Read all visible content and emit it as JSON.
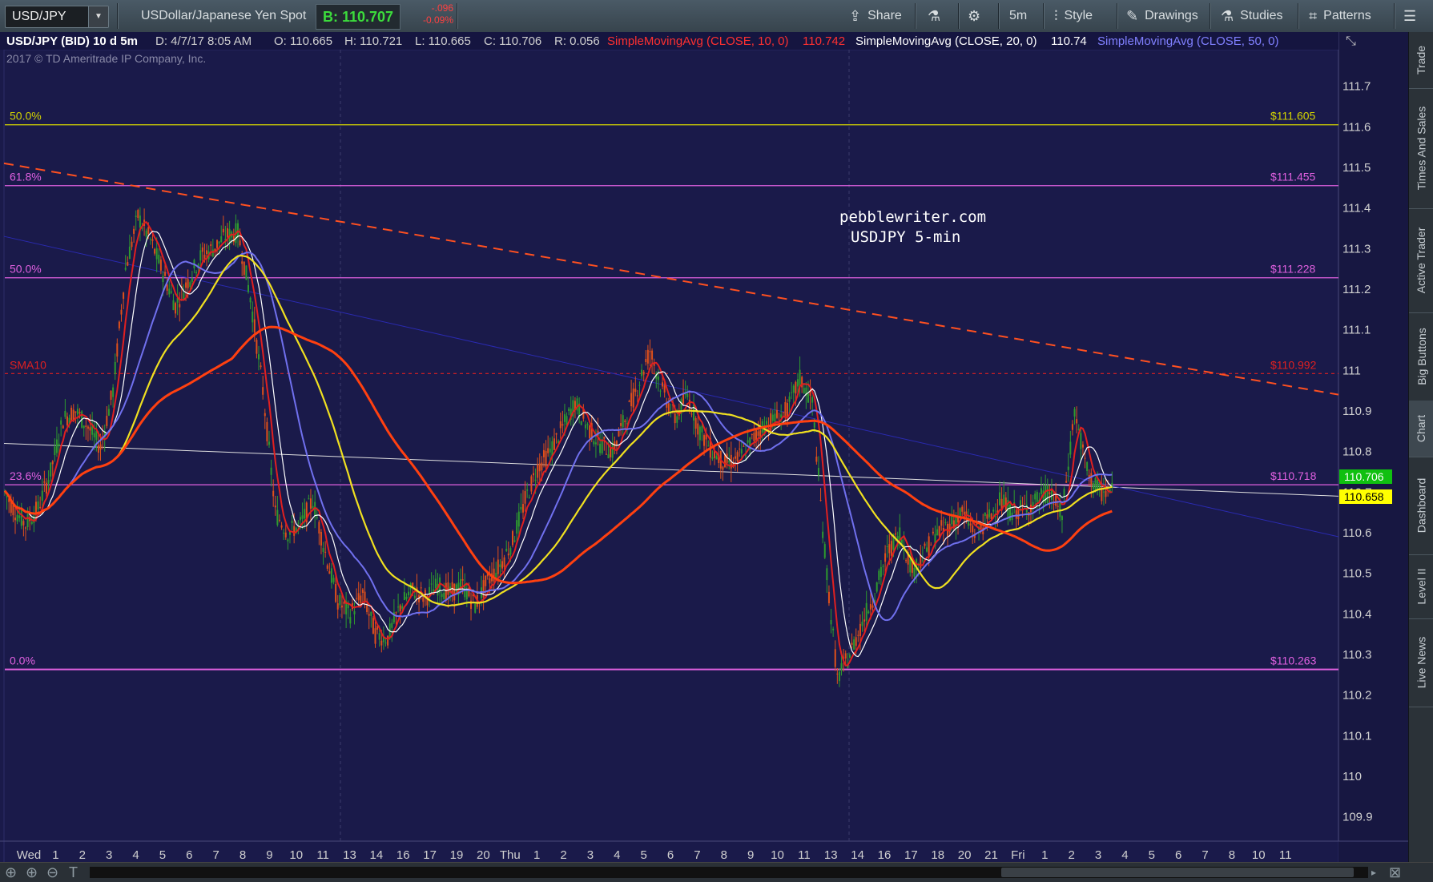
{
  "toolbar": {
    "symbol": "USD/JPY",
    "description": "USDollar/Japanese Yen Spot",
    "bid": "B: 110.707",
    "change": "-.096",
    "change_pct": "-0.09%",
    "share_label": "Share",
    "timeframe_label": "5m",
    "style_label": "Style",
    "drawings_label": "Drawings",
    "studies_label": "Studies",
    "patterns_label": "Patterns"
  },
  "header": {
    "instrument": "USD/JPY (BID) 10 d 5m",
    "date": "D: 4/7/17 8:05 AM",
    "open": "O: 110.665",
    "high": "H: 110.721",
    "low": "L: 110.665",
    "close": "C: 110.706",
    "range": "R: 0.056",
    "sma10_label": "SimpleMovingAvg (CLOSE, 10, 0)",
    "sma10_value": "110.742",
    "sma20_label": "SimpleMovingAvg (CLOSE, 20, 0)",
    "sma20_value": "110.74",
    "sma50_label": "SimpleMovingAvg (CLOSE, 50, 0)",
    "copyright": "2017 © TD Ameritrade IP Company, Inc."
  },
  "annotation": {
    "line1": "pebblewriter.com",
    "line2": "USDJPY 5-min"
  },
  "colors": {
    "background": "#1a1a4a",
    "candle_up": "#2e9a2e",
    "candle_down": "#e0501a",
    "sma10": "#e02020",
    "sma20": "#ffffff",
    "sma50": "#7070ee",
    "yellow_ma": "#f0e020",
    "orange_ma": "#ff4010",
    "fib_line": "#e060e0",
    "fib50_top": "#d4d400",
    "trendline_dashed": "#ff5020",
    "bid_label_bg": "#10c010",
    "price_label_bg": "#ffff00"
  },
  "side_tabs": [
    "Trade",
    "Times And Sales",
    "Active Trader",
    "Big Buttons",
    "Chart",
    "Dashboard",
    "Level II",
    "Live News"
  ],
  "chart_data": {
    "type": "candlestick",
    "title": "USDJPY 5-min",
    "ylim": [
      109.84,
      111.79
    ],
    "y_ticks": [
      "111.7",
      "111.6",
      "111.5",
      "111.4",
      "111.3",
      "111.2",
      "111.1",
      "111",
      "110.9",
      "110.8",
      "110.7",
      "110.6",
      "110.5",
      "110.4",
      "110.3",
      "110.2",
      "110.1",
      "110",
      "109.9"
    ],
    "x_ticks": [
      "Wed",
      "1",
      "2",
      "3",
      "4",
      "5",
      "6",
      "7",
      "8",
      "9",
      "10",
      "11",
      "13",
      "14",
      "16",
      "17",
      "19",
      "20",
      "Thu",
      "1",
      "2",
      "3",
      "4",
      "5",
      "6",
      "7",
      "8",
      "9",
      "10",
      "11",
      "13",
      "14",
      "16",
      "17",
      "18",
      "20",
      "21",
      "Fri",
      "1",
      "2",
      "3",
      "4",
      "5",
      "6",
      "7",
      "8",
      "10",
      "11"
    ],
    "fib_levels": [
      {
        "label": "50.0%",
        "value": 111.605,
        "price_label": "$111.605"
      },
      {
        "label": "61.8%",
        "value": 111.455,
        "price_label": "$111.455"
      },
      {
        "label": "50.0%",
        "value": 111.228,
        "price_label": "$111.228"
      },
      {
        "label": "SMA10",
        "value": 110.992,
        "price_label": "$110.992"
      },
      {
        "label": "23.6%",
        "value": 110.718,
        "price_label": "$110.718"
      },
      {
        "label": "0.0%",
        "value": 110.263,
        "price_label": "$110.263"
      }
    ],
    "current_bid_label": "110.706",
    "current_ma_label": "110.658",
    "series": [
      {
        "name": "price",
        "t": [
          0,
          2,
          5,
          8,
          11,
          14,
          17,
          20,
          23,
          26,
          29,
          32,
          35,
          38,
          41,
          44,
          47,
          50,
          53,
          56,
          59,
          62,
          65,
          68,
          71,
          74,
          77,
          80,
          83,
          86,
          89,
          92,
          95,
          98,
          101,
          104,
          107,
          110,
          113,
          116,
          119,
          122,
          125,
          128,
          131,
          134,
          137,
          140,
          143,
          146,
          149,
          152,
          155,
          158,
          161,
          164,
          167,
          170,
          173,
          176,
          179,
          182,
          185,
          188,
          191,
          194,
          197,
          200,
          203,
          206,
          209,
          212,
          215,
          218,
          221,
          224,
          227,
          230,
          233,
          236,
          239,
          242,
          245,
          248,
          251,
          254,
          257,
          260,
          263,
          266,
          269,
          272,
          275,
          278,
          281,
          284,
          287,
          290,
          293,
          296,
          299
        ],
        "v": [
          110.7,
          110.66,
          110.62,
          110.66,
          110.75,
          110.88,
          110.9,
          110.86,
          110.81,
          110.95,
          111.25,
          111.38,
          111.32,
          111.24,
          111.16,
          111.22,
          111.28,
          111.3,
          111.33,
          111.34,
          111.18,
          110.95,
          110.65,
          110.6,
          110.62,
          110.68,
          110.55,
          110.43,
          110.4,
          110.45,
          110.35,
          110.34,
          110.42,
          110.46,
          110.44,
          110.47,
          110.45,
          110.47,
          110.42,
          110.48,
          110.52,
          110.58,
          110.68,
          110.76,
          110.8,
          110.86,
          110.92,
          110.86,
          110.82,
          110.8,
          110.88,
          110.96,
          111.05,
          110.95,
          110.88,
          110.94,
          110.85,
          110.8,
          110.77,
          110.78,
          110.82,
          110.86,
          110.88,
          110.9,
          110.98,
          110.92,
          110.55,
          110.24,
          110.3,
          110.38,
          110.45,
          110.55,
          110.6,
          110.51,
          110.55,
          110.6,
          110.62,
          110.65,
          110.6,
          110.63,
          110.68,
          110.65,
          110.66,
          110.68,
          110.7,
          110.64,
          110.9,
          110.75,
          110.7,
          110.7
        ]
      }
    ]
  }
}
